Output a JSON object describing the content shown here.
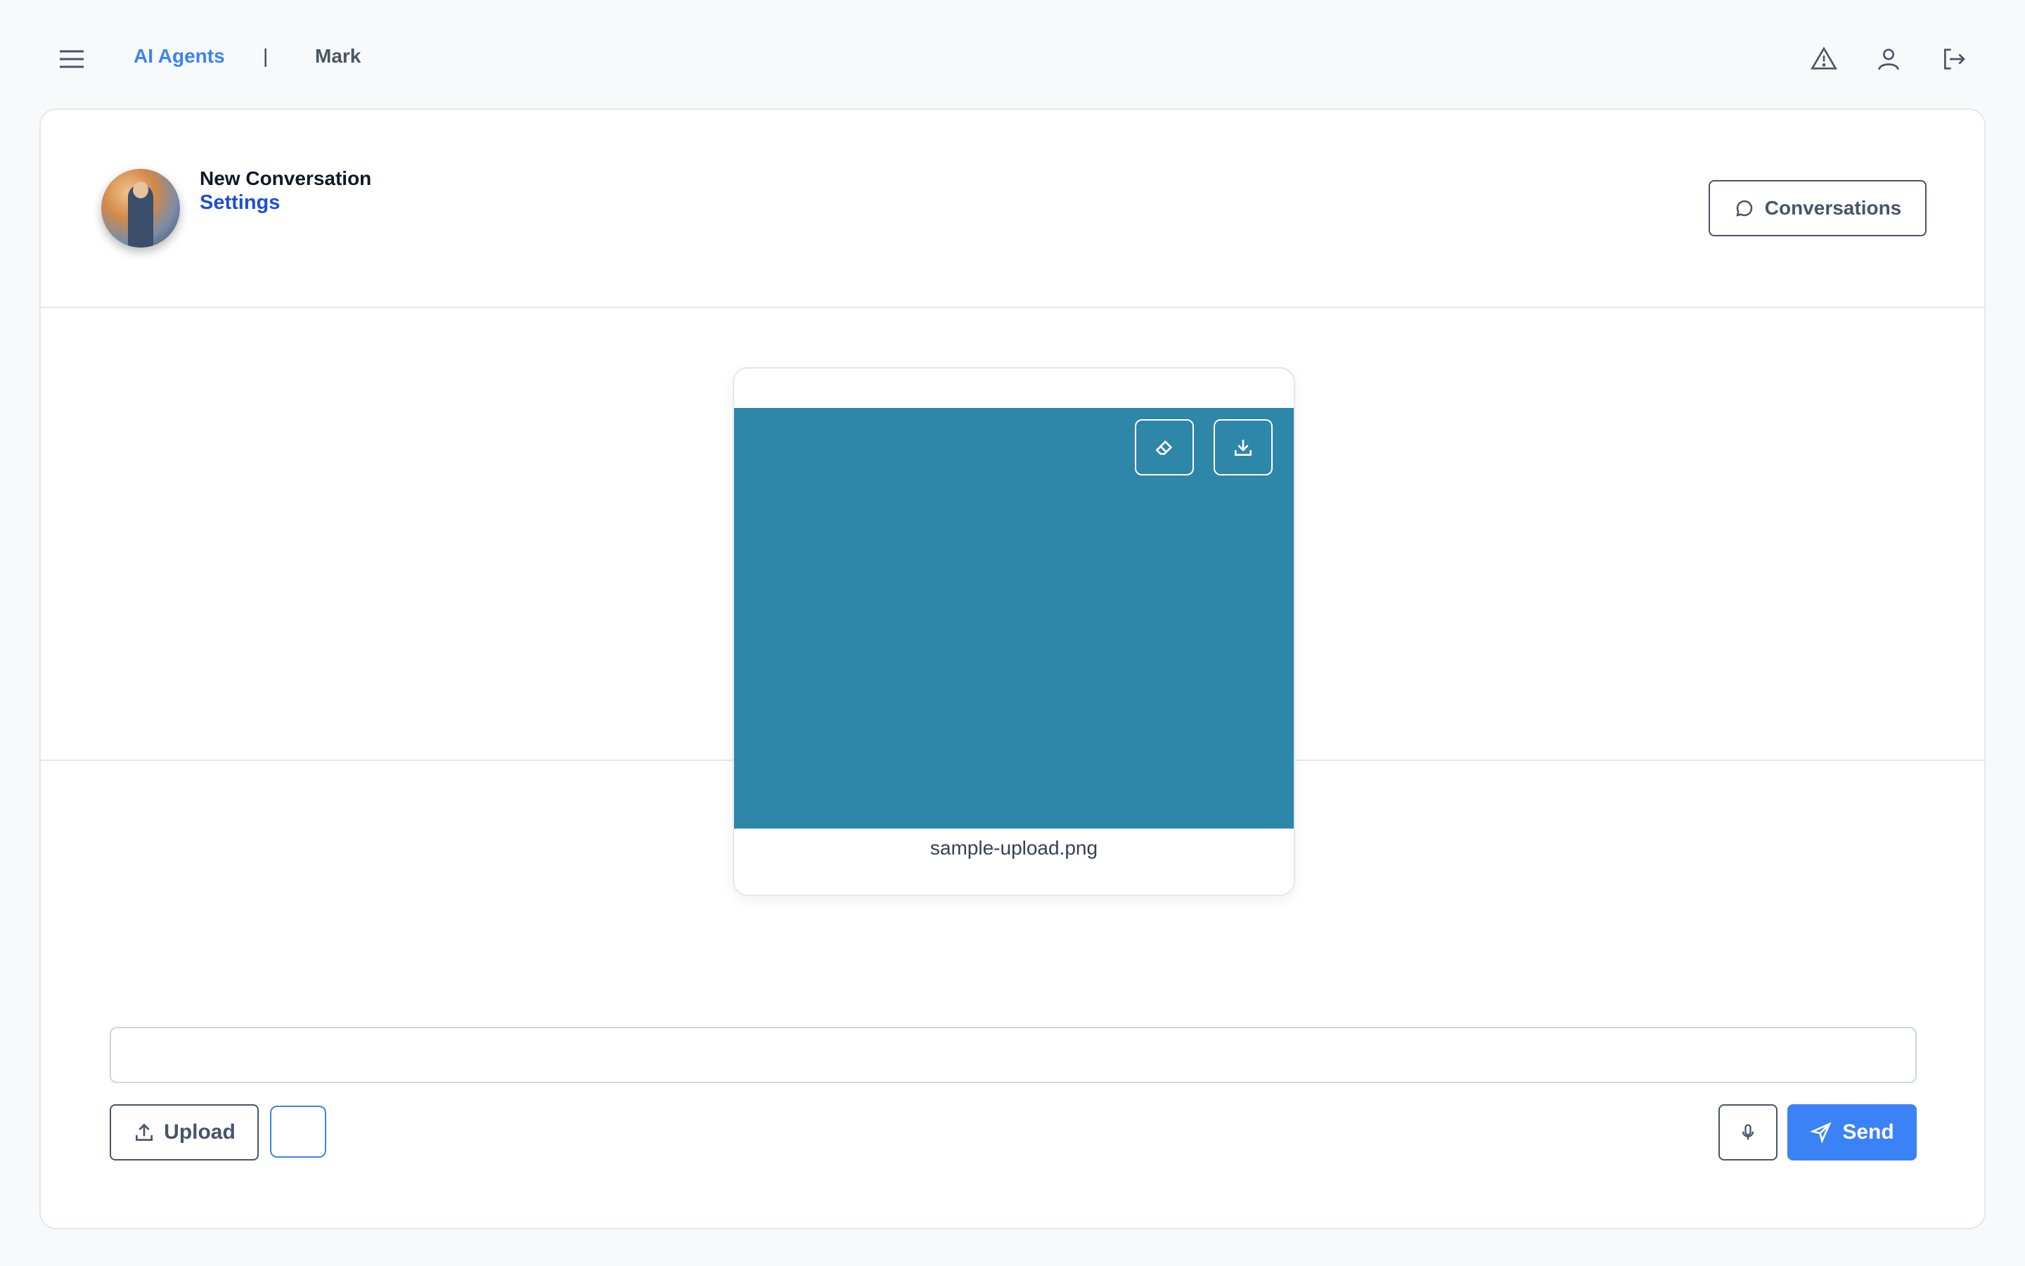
{
  "nav": {
    "brand": "AI Agents",
    "separator": "|",
    "user_name": "Mark",
    "icons": [
      "menu-icon",
      "warning-icon",
      "user-icon",
      "logout-icon"
    ]
  },
  "header": {
    "conversation_title": "New Conversation",
    "settings_label": "Settings",
    "conversations_button": "Conversations"
  },
  "upload_preview": {
    "file_name": "sample-upload.png",
    "preview_color": "#2e86a9",
    "actions": [
      "eraser-icon",
      "download-icon"
    ]
  },
  "composer": {
    "input_value": "",
    "upload_label": "Upload",
    "send_label": "Send"
  },
  "colors": {
    "accent": "#3b82f6",
    "link": "#1d4ed8",
    "background": "#f7f9fb"
  }
}
